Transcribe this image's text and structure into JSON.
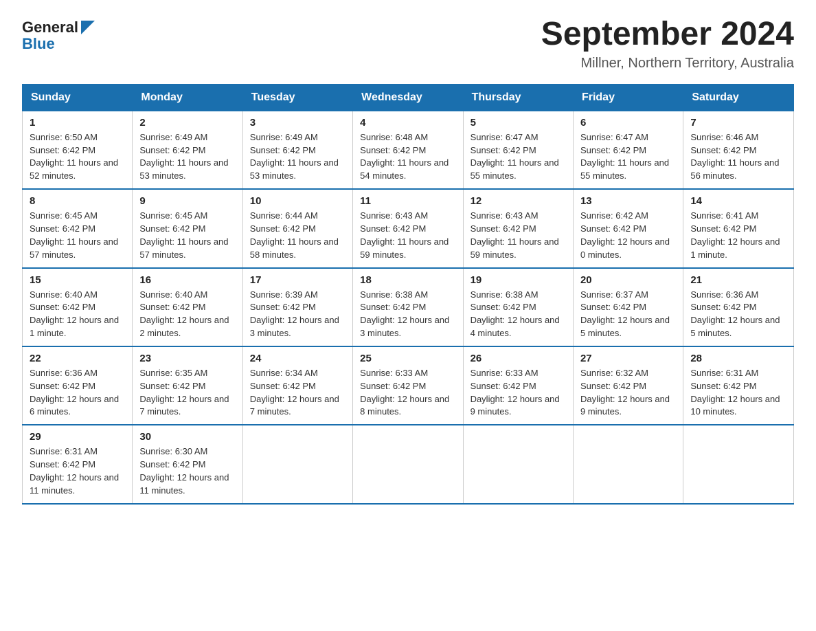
{
  "header": {
    "logo_general": "General",
    "logo_blue": "Blue",
    "title": "September 2024",
    "subtitle": "Millner, Northern Territory, Australia"
  },
  "calendar": {
    "days_of_week": [
      "Sunday",
      "Monday",
      "Tuesday",
      "Wednesday",
      "Thursday",
      "Friday",
      "Saturday"
    ],
    "weeks": [
      [
        {
          "day": "1",
          "sunrise": "6:50 AM",
          "sunset": "6:42 PM",
          "daylight": "11 hours and 52 minutes."
        },
        {
          "day": "2",
          "sunrise": "6:49 AM",
          "sunset": "6:42 PM",
          "daylight": "11 hours and 53 minutes."
        },
        {
          "day": "3",
          "sunrise": "6:49 AM",
          "sunset": "6:42 PM",
          "daylight": "11 hours and 53 minutes."
        },
        {
          "day": "4",
          "sunrise": "6:48 AM",
          "sunset": "6:42 PM",
          "daylight": "11 hours and 54 minutes."
        },
        {
          "day": "5",
          "sunrise": "6:47 AM",
          "sunset": "6:42 PM",
          "daylight": "11 hours and 55 minutes."
        },
        {
          "day": "6",
          "sunrise": "6:47 AM",
          "sunset": "6:42 PM",
          "daylight": "11 hours and 55 minutes."
        },
        {
          "day": "7",
          "sunrise": "6:46 AM",
          "sunset": "6:42 PM",
          "daylight": "11 hours and 56 minutes."
        }
      ],
      [
        {
          "day": "8",
          "sunrise": "6:45 AM",
          "sunset": "6:42 PM",
          "daylight": "11 hours and 57 minutes."
        },
        {
          "day": "9",
          "sunrise": "6:45 AM",
          "sunset": "6:42 PM",
          "daylight": "11 hours and 57 minutes."
        },
        {
          "day": "10",
          "sunrise": "6:44 AM",
          "sunset": "6:42 PM",
          "daylight": "11 hours and 58 minutes."
        },
        {
          "day": "11",
          "sunrise": "6:43 AM",
          "sunset": "6:42 PM",
          "daylight": "11 hours and 59 minutes."
        },
        {
          "day": "12",
          "sunrise": "6:43 AM",
          "sunset": "6:42 PM",
          "daylight": "11 hours and 59 minutes."
        },
        {
          "day": "13",
          "sunrise": "6:42 AM",
          "sunset": "6:42 PM",
          "daylight": "12 hours and 0 minutes."
        },
        {
          "day": "14",
          "sunrise": "6:41 AM",
          "sunset": "6:42 PM",
          "daylight": "12 hours and 1 minute."
        }
      ],
      [
        {
          "day": "15",
          "sunrise": "6:40 AM",
          "sunset": "6:42 PM",
          "daylight": "12 hours and 1 minute."
        },
        {
          "day": "16",
          "sunrise": "6:40 AM",
          "sunset": "6:42 PM",
          "daylight": "12 hours and 2 minutes."
        },
        {
          "day": "17",
          "sunrise": "6:39 AM",
          "sunset": "6:42 PM",
          "daylight": "12 hours and 3 minutes."
        },
        {
          "day": "18",
          "sunrise": "6:38 AM",
          "sunset": "6:42 PM",
          "daylight": "12 hours and 3 minutes."
        },
        {
          "day": "19",
          "sunrise": "6:38 AM",
          "sunset": "6:42 PM",
          "daylight": "12 hours and 4 minutes."
        },
        {
          "day": "20",
          "sunrise": "6:37 AM",
          "sunset": "6:42 PM",
          "daylight": "12 hours and 5 minutes."
        },
        {
          "day": "21",
          "sunrise": "6:36 AM",
          "sunset": "6:42 PM",
          "daylight": "12 hours and 5 minutes."
        }
      ],
      [
        {
          "day": "22",
          "sunrise": "6:36 AM",
          "sunset": "6:42 PM",
          "daylight": "12 hours and 6 minutes."
        },
        {
          "day": "23",
          "sunrise": "6:35 AM",
          "sunset": "6:42 PM",
          "daylight": "12 hours and 7 minutes."
        },
        {
          "day": "24",
          "sunrise": "6:34 AM",
          "sunset": "6:42 PM",
          "daylight": "12 hours and 7 minutes."
        },
        {
          "day": "25",
          "sunrise": "6:33 AM",
          "sunset": "6:42 PM",
          "daylight": "12 hours and 8 minutes."
        },
        {
          "day": "26",
          "sunrise": "6:33 AM",
          "sunset": "6:42 PM",
          "daylight": "12 hours and 9 minutes."
        },
        {
          "day": "27",
          "sunrise": "6:32 AM",
          "sunset": "6:42 PM",
          "daylight": "12 hours and 9 minutes."
        },
        {
          "day": "28",
          "sunrise": "6:31 AM",
          "sunset": "6:42 PM",
          "daylight": "12 hours and 10 minutes."
        }
      ],
      [
        {
          "day": "29",
          "sunrise": "6:31 AM",
          "sunset": "6:42 PM",
          "daylight": "12 hours and 11 minutes."
        },
        {
          "day": "30",
          "sunrise": "6:30 AM",
          "sunset": "6:42 PM",
          "daylight": "12 hours and 11 minutes."
        },
        null,
        null,
        null,
        null,
        null
      ]
    ],
    "sunrise_label": "Sunrise:",
    "sunset_label": "Sunset:",
    "daylight_label": "Daylight:"
  }
}
